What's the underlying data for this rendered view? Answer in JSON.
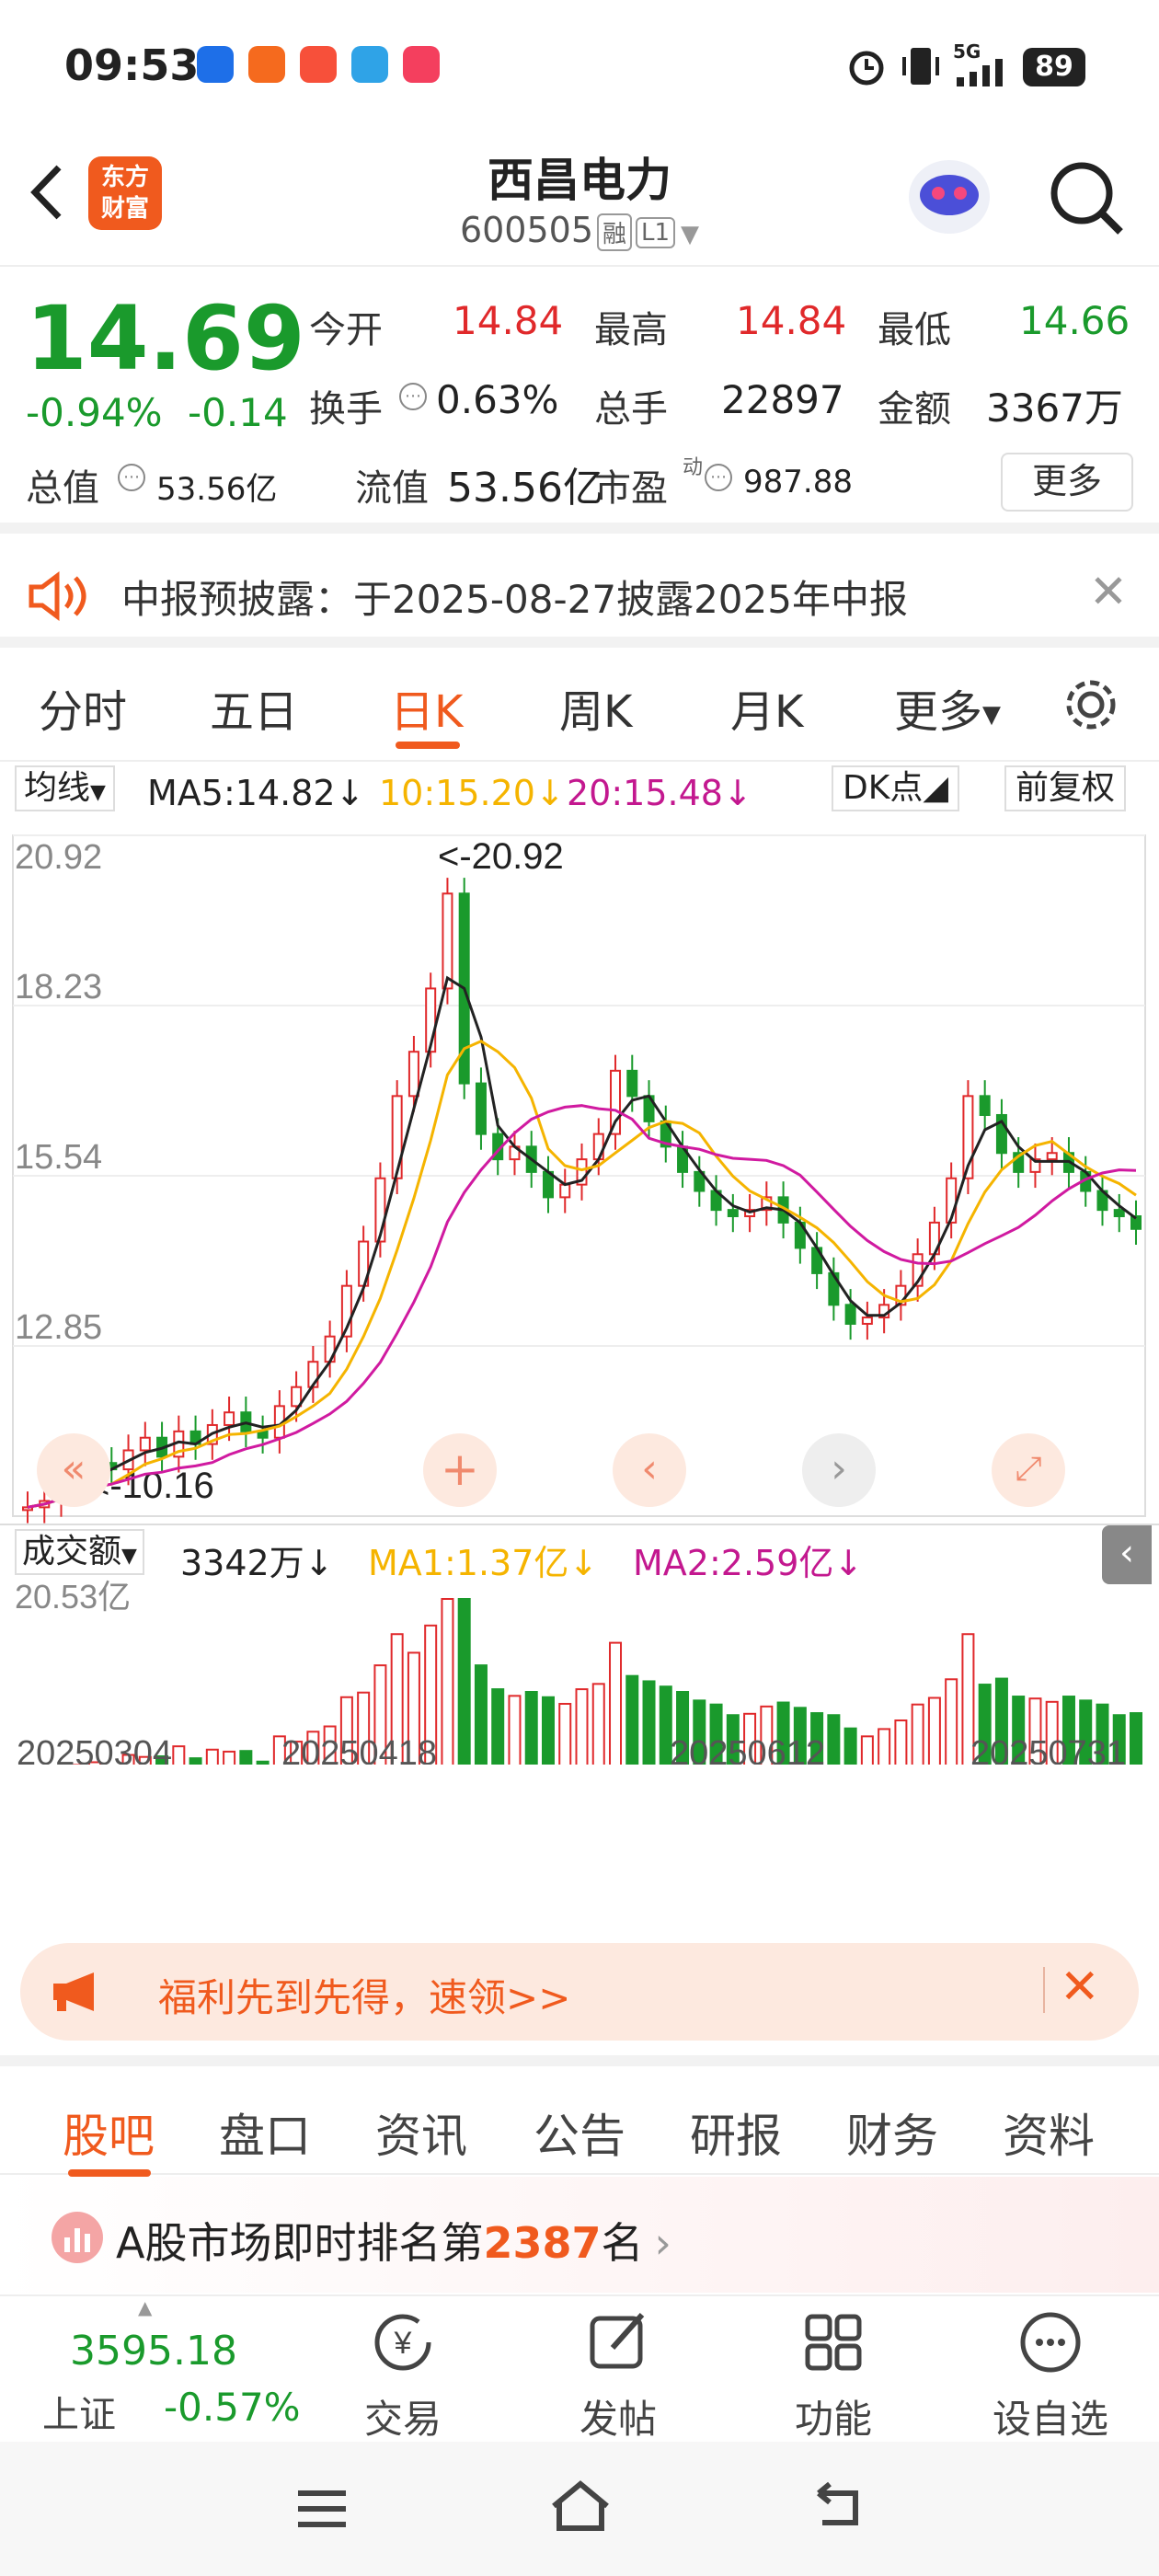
{
  "status": {
    "time": "09:53",
    "battery": "89",
    "network": "5G"
  },
  "header": {
    "name": "西昌电力",
    "code": "600505",
    "tag1": "融",
    "tag2": "L1",
    "logo": "东方\n财富"
  },
  "quote": {
    "price": "14.69",
    "pct": "-0.94%",
    "chg": "-0.14",
    "open_label": "今开",
    "open": "14.84",
    "high_label": "最高",
    "high": "14.84",
    "low_label": "最低",
    "low": "14.66",
    "turnover_label": "换手",
    "turnover": "0.63%",
    "volume_label": "总手",
    "volume": "22897",
    "amount_label": "金额",
    "amount": "3367万",
    "mktcap_label": "总值",
    "mktcap": "53.56亿",
    "float_label": "流值",
    "float": "53.56亿",
    "pe_label": "市盈",
    "pe_sup": "动",
    "pe": "987.88",
    "more": "更多"
  },
  "notice": {
    "text": "中报预披露：于2025-08-27披露2025年中报"
  },
  "ktabs": [
    "分时",
    "五日",
    "日K",
    "周K",
    "月K",
    "更多"
  ],
  "chart_bar": {
    "ma_sel": "均线",
    "ma5": "MA5:14.82",
    "ma10": "10:15.20",
    "ma20": "20:15.48",
    "dk": "DK点",
    "adj": "前复权"
  },
  "vol_bar": {
    "sel": "成交额",
    "val": "3342万",
    "ma1": "MA1:1.37亿",
    "ma2": "MA2:2.59亿",
    "top": "20.53亿"
  },
  "chart_data": {
    "type": "candlestick",
    "y_ticks": [
      "20.92",
      "18.23",
      "15.54",
      "12.85"
    ],
    "ylim": [
      10.16,
      20.92
    ],
    "max_label": "<-20.92",
    "min_label": "<-10.16",
    "x_labels": [
      "20250304",
      "20250418",
      "20250612",
      "20250731"
    ],
    "ma_colors": {
      "ma5": "#222222",
      "ma10": "#f5b400",
      "ma20": "#d01aa0"
    }
  },
  "banner": {
    "text": "福利先到先得，速领>>"
  },
  "ltabs": [
    "股吧",
    "盘口",
    "资讯",
    "公告",
    "研报",
    "财务",
    "资料"
  ],
  "rank": {
    "pre": "A股市场即时排名第",
    "num": "2387",
    "post": "名"
  },
  "bottom": {
    "index_val": "3595.18",
    "index_name": "上证",
    "index_pct": "-0.57%",
    "trade": "交易",
    "post": "发帖",
    "func": "功能",
    "watch": "设自选"
  },
  "colors": {
    "up": "#e0292b",
    "down": "#1a9a2c",
    "accent": "#f05a1e"
  }
}
